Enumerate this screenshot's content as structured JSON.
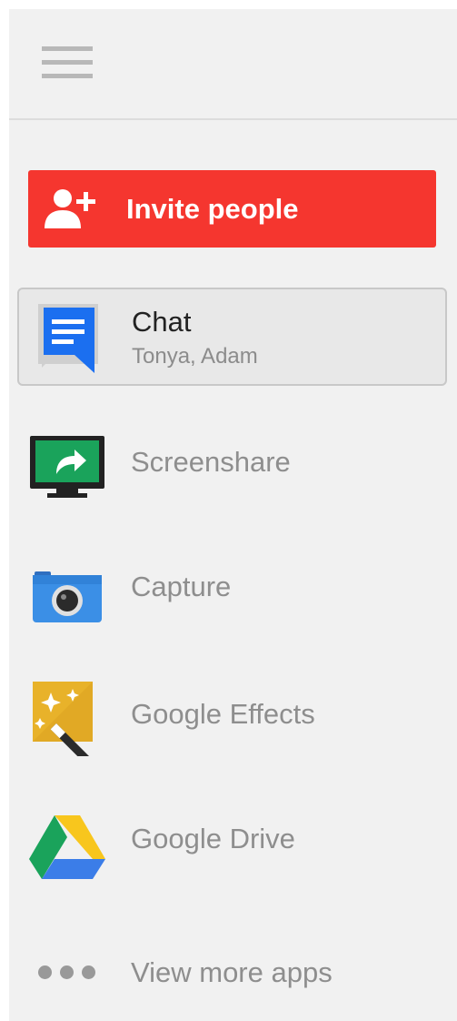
{
  "header": {
    "menu_icon": "hamburger-menu-icon"
  },
  "invite": {
    "label": "Invite people",
    "icon": "add-person-icon",
    "color": "#f5362f"
  },
  "apps": {
    "chat": {
      "title": "Chat",
      "subtitle": "Tonya, Adam",
      "icon": "chat-bubble-icon",
      "selected": true
    },
    "screenshare": {
      "label": "Screenshare",
      "icon": "screenshare-icon"
    },
    "capture": {
      "label": "Capture",
      "icon": "camera-icon"
    },
    "effects": {
      "label": "Google Effects",
      "icon": "magic-wand-icon"
    },
    "drive": {
      "label": "Google Drive",
      "icon": "google-drive-icon"
    },
    "more": {
      "label": "View more apps",
      "icon": "more-dots-icon"
    }
  }
}
